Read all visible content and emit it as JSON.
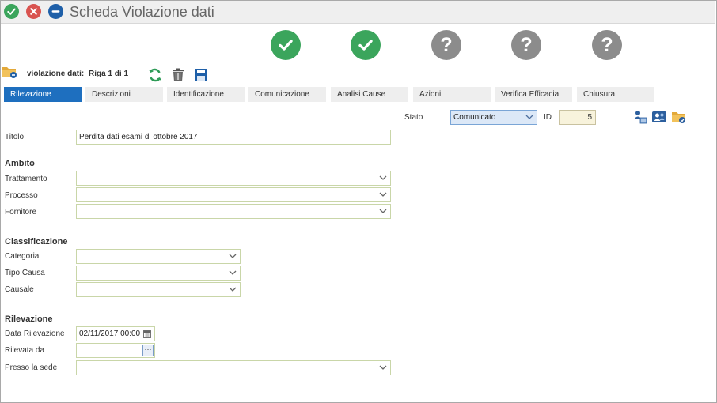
{
  "window": {
    "title": "Scheda Violazione dati"
  },
  "steps": [
    "done",
    "done",
    "todo",
    "todo",
    "todo"
  ],
  "nav": {
    "label": "violazione dati:",
    "record": "Riga 1 di 1"
  },
  "tabs": [
    "Rilevazione",
    "Descrizioni",
    "Identificazione",
    "Comunicazione",
    "Analisi Cause",
    "Azioni",
    "Verifica Efficacia",
    "Chiusura"
  ],
  "active_tab": "Rilevazione",
  "header": {
    "stato_label": "Stato",
    "stato_value": "Comunicato",
    "id_label": "ID",
    "id_value": "5"
  },
  "titolo": {
    "label": "Titolo",
    "value": "Perdita dati esami di ottobre 2017"
  },
  "ambito": {
    "heading": "Ambito",
    "trattamento_label": "Trattamento",
    "trattamento_value": "",
    "processo_label": "Processo",
    "processo_value": "",
    "fornitore_label": "Fornitore",
    "fornitore_value": ""
  },
  "classificazione": {
    "heading": "Classificazione",
    "categoria_label": "Categoria",
    "categoria_value": "",
    "tipo_causa_label": "Tipo Causa",
    "tipo_causa_value": "",
    "causale_label": "Causale",
    "causale_value": ""
  },
  "rilevazione": {
    "heading": "Rilevazione",
    "data_label": "Data Rilevazione",
    "data_value": "02/11/2017 00:00",
    "rilevata_label": "Rilevata da",
    "rilevata_value": "",
    "sede_label": "Presso la sede",
    "sede_value": ""
  },
  "colors": {
    "accent": "#1e6fbf",
    "success": "#3ba55c",
    "danger": "#d9534f",
    "neutral": "#8c8c8c"
  }
}
